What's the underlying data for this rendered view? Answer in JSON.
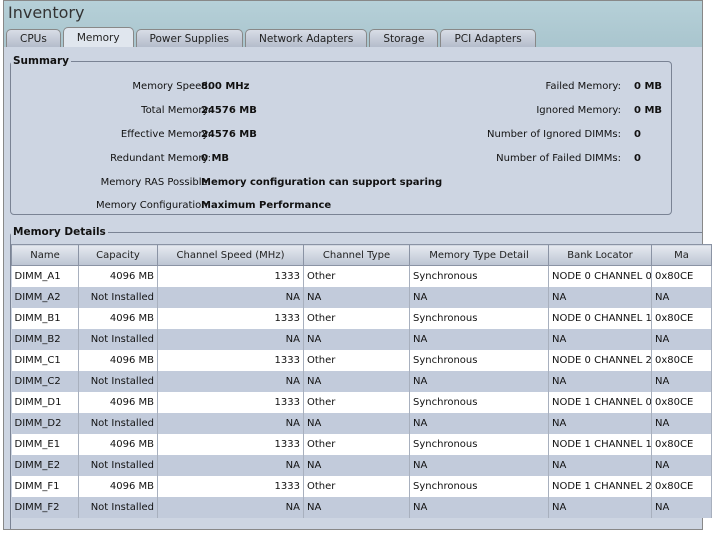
{
  "window": {
    "title": "Inventory"
  },
  "tabs": [
    "CPUs",
    "Memory",
    "Power Supplies",
    "Network Adapters",
    "Storage",
    "PCI Adapters"
  ],
  "active_tab": "Memory",
  "summary": {
    "legend": "Summary",
    "left": [
      {
        "label": "Memory Speed:",
        "value": "800 MHz"
      },
      {
        "label": "Total Memory:",
        "value": "24576 MB"
      },
      {
        "label": "Effective Memory:",
        "value": "24576 MB"
      },
      {
        "label": "Redundant Memory:",
        "value": "0 MB"
      },
      {
        "label": "Memory RAS Possible:",
        "value": "Memory configuration can support sparing"
      },
      {
        "label": "Memory Configuration:",
        "value": "Maximum Performance"
      }
    ],
    "right": [
      {
        "label": "Failed Memory:",
        "value": "0 MB"
      },
      {
        "label": "Ignored Memory:",
        "value": "0 MB"
      },
      {
        "label": "Number of Ignored DIMMs:",
        "value": "0"
      },
      {
        "label": "Number of Failed DIMMs:",
        "value": "0"
      }
    ]
  },
  "details": {
    "legend": "Memory Details",
    "columns": [
      "Name",
      "Capacity",
      "Channel Speed (MHz)",
      "Channel Type",
      "Memory Type Detail",
      "Bank Locator",
      "Ma"
    ],
    "rows": [
      [
        "DIMM_A1",
        "4096 MB",
        "1333",
        "Other",
        "Synchronous",
        "NODE 0 CHANNEL 0",
        "0x80CE"
      ],
      [
        "DIMM_A2",
        "Not Installed",
        "NA",
        "NA",
        "NA",
        "NA",
        "NA"
      ],
      [
        "DIMM_B1",
        "4096 MB",
        "1333",
        "Other",
        "Synchronous",
        "NODE 0 CHANNEL 1",
        "0x80CE"
      ],
      [
        "DIMM_B2",
        "Not Installed",
        "NA",
        "NA",
        "NA",
        "NA",
        "NA"
      ],
      [
        "DIMM_C1",
        "4096 MB",
        "1333",
        "Other",
        "Synchronous",
        "NODE 0 CHANNEL 2",
        "0x80CE"
      ],
      [
        "DIMM_C2",
        "Not Installed",
        "NA",
        "NA",
        "NA",
        "NA",
        "NA"
      ],
      [
        "DIMM_D1",
        "4096 MB",
        "1333",
        "Other",
        "Synchronous",
        "NODE 1 CHANNEL 0",
        "0x80CE"
      ],
      [
        "DIMM_D2",
        "Not Installed",
        "NA",
        "NA",
        "NA",
        "NA",
        "NA"
      ],
      [
        "DIMM_E1",
        "4096 MB",
        "1333",
        "Other",
        "Synchronous",
        "NODE 1 CHANNEL 1",
        "0x80CE"
      ],
      [
        "DIMM_E2",
        "Not Installed",
        "NA",
        "NA",
        "NA",
        "NA",
        "NA"
      ],
      [
        "DIMM_F1",
        "4096 MB",
        "1333",
        "Other",
        "Synchronous",
        "NODE 1 CHANNEL 2",
        "0x80CE"
      ],
      [
        "DIMM_F2",
        "Not Installed",
        "NA",
        "NA",
        "NA",
        "NA",
        "NA"
      ]
    ]
  }
}
